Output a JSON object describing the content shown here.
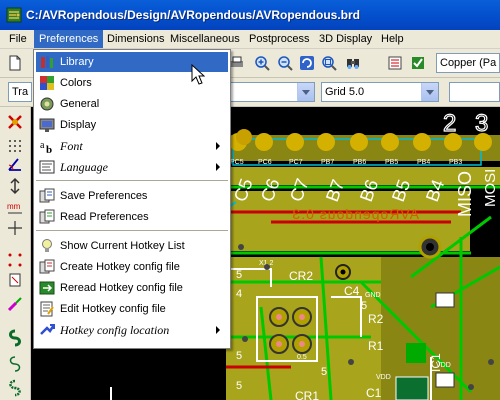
{
  "window": {
    "title": "C:/AVRopendous/Design/AVRopendous/AVRopendous.brd"
  },
  "menubar": {
    "items": [
      {
        "label": "File"
      },
      {
        "label": "Preferences",
        "active": true
      },
      {
        "label": "Dimensions"
      },
      {
        "label": "Miscellaneous"
      },
      {
        "label": "Postprocess"
      },
      {
        "label": "3D Display"
      },
      {
        "label": "Help"
      }
    ]
  },
  "toolbar": {
    "layer_select": "Copper (Pa",
    "track_select": "Tra",
    "grid_select": "Grid 5.0"
  },
  "preferences_menu": {
    "items": [
      {
        "label": "Library",
        "icon": "library-icon",
        "highlighted": true
      },
      {
        "label": "Colors",
        "icon": "colors-icon"
      },
      {
        "label": "General",
        "icon": "general-icon"
      },
      {
        "label": "Display",
        "icon": "display-icon"
      },
      {
        "label": "Font",
        "icon": "font-icon",
        "italic": true,
        "submenu": true
      },
      {
        "label": "Language",
        "icon": "language-icon",
        "italic": true,
        "submenu": true
      },
      {
        "label": "Save Preferences",
        "icon": "save-preferences-icon"
      },
      {
        "label": "Read Preferences",
        "icon": "read-preferences-icon"
      },
      {
        "label": "Show Current Hotkey List",
        "icon": "hotkey-list-icon"
      },
      {
        "label": "Create Hotkey config file",
        "icon": "create-hotkey-icon"
      },
      {
        "label": "Reread Hotkey config file",
        "icon": "reread-hotkey-icon"
      },
      {
        "label": "Edit Hotkey config file",
        "icon": "edit-hotkey-icon"
      },
      {
        "label": "Hotkey config location",
        "icon": "hotkey-location-icon",
        "italic": true,
        "submenu": true
      }
    ]
  },
  "pcb": {
    "pin_labels": [
      "PC5",
      "PC6",
      "PC7",
      "PB7",
      "PB6",
      "PB5",
      "PB4",
      "PB3"
    ],
    "net_labels": [
      "C5",
      "C6",
      "C7",
      "B7",
      "B6",
      "B5",
      "B4"
    ],
    "big_labels": [
      "MISO",
      "MOSI"
    ],
    "component_labels": [
      "CR2",
      "C4",
      "R2",
      "R1",
      "CR1",
      "IC1",
      "C1"
    ],
    "pad_numbers": [
      "5",
      "5",
      "5",
      "5",
      "4",
      "5"
    ],
    "small_labels": [
      "GND",
      "VDD",
      "VDD",
      "X1.2"
    ],
    "mirrored_text": "AVRopendous 0.3",
    "corner_digits": [
      "2",
      "3"
    ],
    "track_width_label": "0.5"
  },
  "colors": {
    "title_bar": "#0a5fd8",
    "menu_highlight": "#316ac5",
    "pcb_background": "#000000",
    "copper_fill": "#a8a41c",
    "green_track": "#00c800",
    "red_track": "#c80000",
    "silkscreen": "#ffffff",
    "annotation_cyan": "#00bcd8"
  }
}
